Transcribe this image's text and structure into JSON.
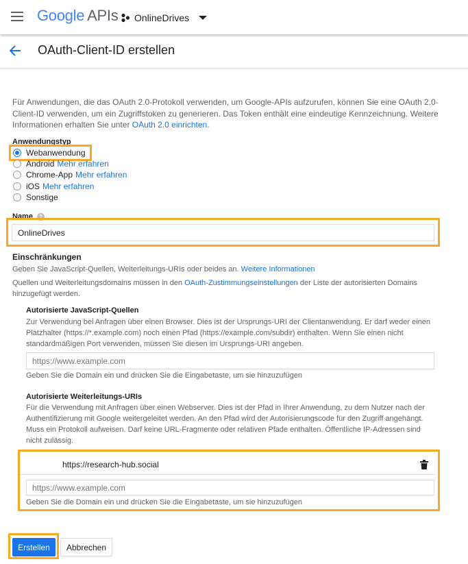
{
  "header": {
    "logo_google": "Google",
    "logo_apis": "APIs",
    "project_name": "OnlineDrives"
  },
  "page": {
    "title": "OAuth-Client-ID erstellen"
  },
  "intro": {
    "text_1": "Für Anwendungen, die das OAuth 2.0-Protokoll verwenden, um Google-APIs aufzurufen, können Sie eine OAuth 2.0-Client-ID verwenden, um ein Zugriffstoken zu generieren. Das Token enthält eine eindeutige Kennzeichnung. Weitere Informationen erhalten Sie unter ",
    "link": "OAuth 2.0 einrichten",
    "text_2": "."
  },
  "app_type": {
    "label": "Anwendungstyp",
    "options": [
      {
        "label": "Webanwendung",
        "more": "",
        "checked": true
      },
      {
        "label": "Android",
        "more": "Mehr erfahren",
        "checked": false
      },
      {
        "label": "Chrome-App",
        "more": "Mehr erfahren",
        "checked": false
      },
      {
        "label": "iOS",
        "more": "Mehr erfahren",
        "checked": false
      },
      {
        "label": "Sonstige",
        "more": "",
        "checked": false
      }
    ]
  },
  "name_field": {
    "label": "Name",
    "value": "OnlineDrives"
  },
  "restrictions": {
    "title": "Einschränkungen",
    "desc_1": "Geben Sie JavaScript-Quellen, Weiterleitungs-URIs oder beides an.",
    "desc_1_link": "Weitere Informationen",
    "desc_2_a": "Quellen und Weiterleitungsdomains müssen in den ",
    "desc_2_link": "OAuth-Zustimmungseinstellungen",
    "desc_2_b": " der Liste der autorisierten Domains hinzugefügt werden."
  },
  "js_origins": {
    "title": "Autorisierte JavaScript-Quellen",
    "desc": "Zur Verwendung bei Anfragen über einen Browser. Dies ist der Ursprungs-URI der Clientanwendung. Er darf weder einen Platzhalter (https://*.example.com) noch einen Pfad (https://example.com/subdir) enthalten. Wenn Sie einen nicht standardmäßigen Port verwenden, müssen Sie diesen im Ursprungs-URI angeben.",
    "placeholder": "https://www.example.com",
    "hint": "Geben Sie die Domain ein und drücken Sie die Eingabetaste, um sie hinzuzufügen"
  },
  "redirect_uris": {
    "title": "Autorisierte Weiterleitungs-URIs",
    "desc": "Für die Verwendung mit Anfragen über einen Webserver. Dies ist der Pfad in Ihrer Anwendung, zu dem Nutzer nach der Authentifizierung mit Google weitergeleitet werden. An den Pfad wird der Autorisierungscode für den Zugriff angehängt. Muss ein Protokoll aufweisen. Darf keine URL-Fragmente oder relativen Pfade enthalten. Öffentliche IP-Adressen sind nicht zulässig.",
    "entries": [
      "https://research-hub.social"
    ],
    "placeholder": "https://www.example.com",
    "hint": "Geben Sie die Domain ein und drücken Sie die Eingabetaste, um sie hinzuzufügen"
  },
  "actions": {
    "create": "Erstellen",
    "cancel": "Abbrechen"
  },
  "colors": {
    "highlight": "#f9a825",
    "primary": "#1a73e8"
  }
}
